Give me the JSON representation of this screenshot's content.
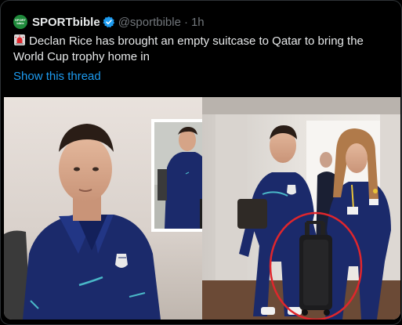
{
  "tweet": {
    "author_name": "SPORTbible",
    "avatar_text": "SPORT bible",
    "handle": "@sportbible",
    "separator": "·",
    "time": "1h",
    "text": "Declan Rice has brought an empty suitcase to Qatar to bring the World Cup trophy home in",
    "show_thread_label": "Show this thread"
  },
  "colors": {
    "background": "#000000",
    "link": "#1d9bf0",
    "verified": "#1d9bf0",
    "avatar_bg": "#1f8a3b",
    "highlight_circle": "#e0262c",
    "jacket": "#1b2a6b"
  },
  "icons": {
    "verified": "verified-badge-icon",
    "siren": "rotating-light-emoji"
  }
}
